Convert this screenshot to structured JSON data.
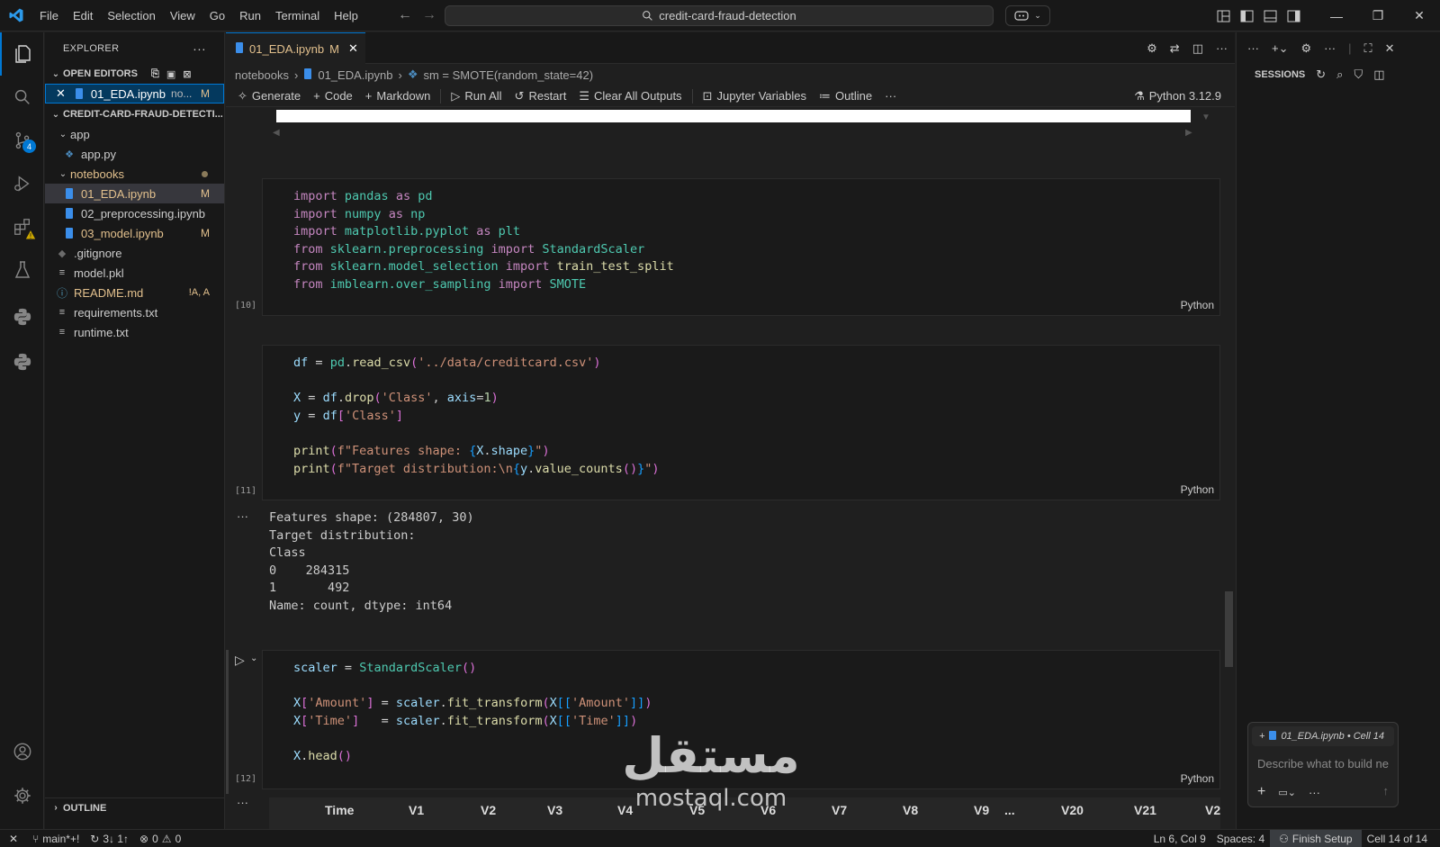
{
  "menu": [
    "File",
    "Edit",
    "Selection",
    "View",
    "Go",
    "Run",
    "Terminal",
    "Help"
  ],
  "search": {
    "text": "credit-card-fraud-detection"
  },
  "sidebar": {
    "title": "EXPLORER",
    "open_editors_label": "OPEN EDITORS",
    "open_editor": {
      "name": "01_EDA.ipynb",
      "path": "no...",
      "status": "M"
    },
    "project_label": "CREDIT-CARD-FRAUD-DETECTI...",
    "tree": [
      {
        "name": "app",
        "kind": "folder"
      },
      {
        "name": "app.py",
        "kind": "file"
      },
      {
        "name": "notebooks",
        "kind": "folder"
      },
      {
        "name": "01_EDA.ipynb",
        "kind": "file",
        "status": "M"
      },
      {
        "name": "02_preprocessing.ipynb",
        "kind": "file"
      },
      {
        "name": "03_model.ipynb",
        "kind": "file",
        "status": "M"
      },
      {
        "name": ".gitignore",
        "kind": "file"
      },
      {
        "name": "model.pkl",
        "kind": "file"
      },
      {
        "name": "README.md",
        "kind": "file",
        "status": "!A, A"
      },
      {
        "name": "requirements.txt",
        "kind": "file"
      },
      {
        "name": "runtime.txt",
        "kind": "file"
      }
    ],
    "outline_label": "OUTLINE"
  },
  "tab": {
    "name": "01_EDA.ipynb",
    "status": "M"
  },
  "breadcrumb": [
    "notebooks",
    "01_EDA.ipynb",
    "sm = SMOTE(random_state=42)"
  ],
  "toolbar": {
    "generate": "Generate",
    "code": "Code",
    "markdown": "Markdown",
    "run_all": "Run All",
    "restart": "Restart",
    "clear": "Clear All Outputs",
    "variables": "Jupyter Variables",
    "outline": "Outline",
    "kernel": "Python 3.12.9"
  },
  "cells": {
    "c10": {
      "exec": "[10]",
      "lang": "Python"
    },
    "c11": {
      "exec": "[11]",
      "lang": "Python"
    },
    "c12": {
      "exec": "[12]",
      "lang": "Python"
    }
  },
  "output11": [
    "Features shape: (284807, 30)",
    "Target distribution:",
    "Class",
    "0    284315",
    "1       492",
    "Name: count, dtype: int64"
  ],
  "table_header": [
    "Time",
    "V1",
    "V2",
    "V3",
    "V4",
    "V5",
    "V6",
    "V7",
    "V8",
    "V9",
    "...",
    "V20",
    "V21",
    "V2"
  ],
  "right_panel": {
    "title": "SESSIONS",
    "context": "01_EDA.ipynb • Cell 14",
    "placeholder": "Describe what to build ne"
  },
  "status": {
    "branch": "main*+!",
    "sync": "3↓ 1↑",
    "errors": "0",
    "warnings": "0",
    "position": "Ln 6, Col 9",
    "spaces": "Spaces: 4",
    "finish": "Finish Setup",
    "cell": "Cell 14 of 14"
  },
  "watermark": {
    "arabic": "مستقل",
    "latin": "mostaql.com"
  }
}
